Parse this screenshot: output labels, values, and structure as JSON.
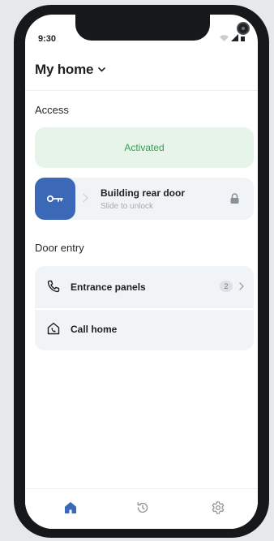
{
  "status_bar": {
    "time": "9:30"
  },
  "header": {
    "title": "My home"
  },
  "access": {
    "section_title": "Access",
    "activated_text": "Activated",
    "door": {
      "title": "Building rear door",
      "subtitle": "Slide to unlock"
    }
  },
  "door_entry": {
    "section_title": "Door entry",
    "items": [
      {
        "label": "Entrance panels",
        "badge": "2"
      },
      {
        "label": "Call home"
      }
    ]
  },
  "tabbar": {
    "active": "home"
  },
  "colors": {
    "accent": "#3b69b8",
    "success_bg": "#e6f4ea",
    "success_text": "#3f9b57",
    "card_bg": "#f1f4f7"
  }
}
